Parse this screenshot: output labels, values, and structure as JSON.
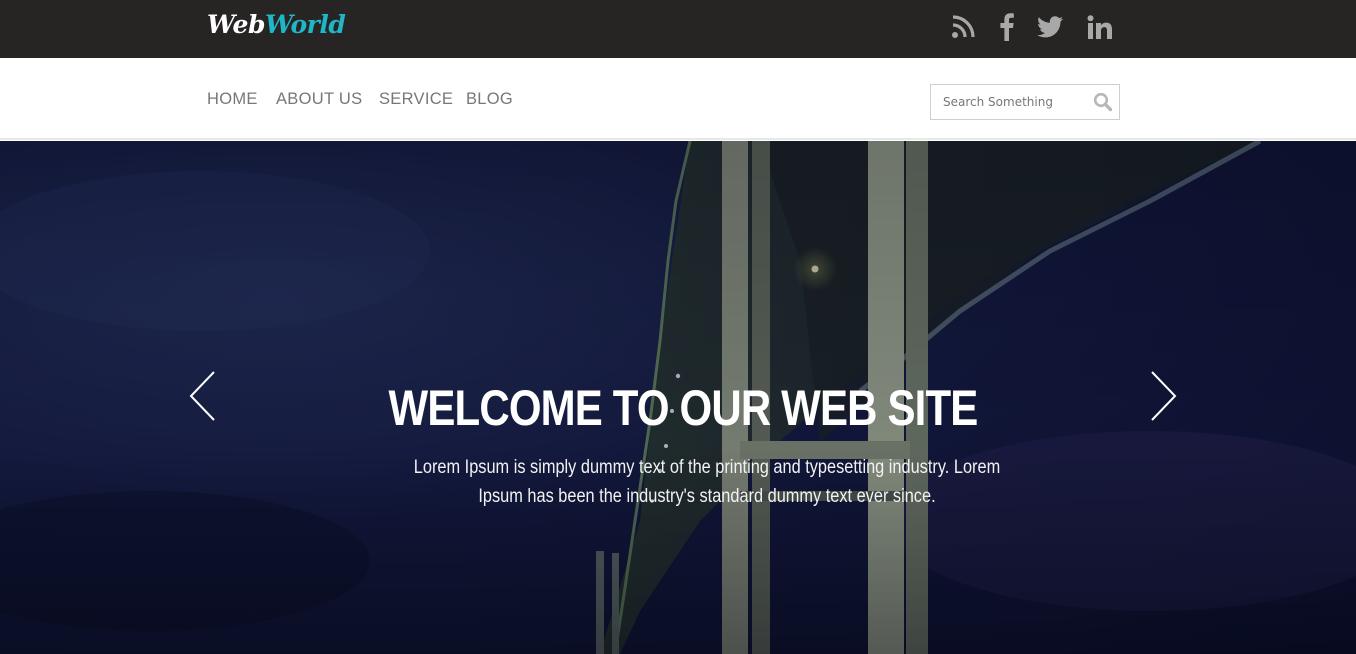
{
  "brand": {
    "logo_part1": "Web",
    "logo_part2": "World",
    "accent": "#1fb7c8"
  },
  "social": {
    "icons": [
      "rss-icon",
      "facebook-icon",
      "twitter-icon",
      "linkedin-icon"
    ],
    "color": "#a8a8a8"
  },
  "nav": {
    "items": [
      {
        "label": "HOME"
      },
      {
        "label": "ABOUT US"
      },
      {
        "label": "SERVICE"
      },
      {
        "label": "BLOG"
      }
    ]
  },
  "search": {
    "placeholder": "Search Something",
    "value": ""
  },
  "hero": {
    "title": "WELCOME TO OUR WEB SITE",
    "text": "Lorem Ipsum is simply dummy text of the printing and typesetting industry. Lorem Ipsum has been the industry's standard dummy text ever since."
  },
  "colors": {
    "topbar": "#272524",
    "nav_text": "#777777",
    "hero_bg": "#141a3f"
  }
}
